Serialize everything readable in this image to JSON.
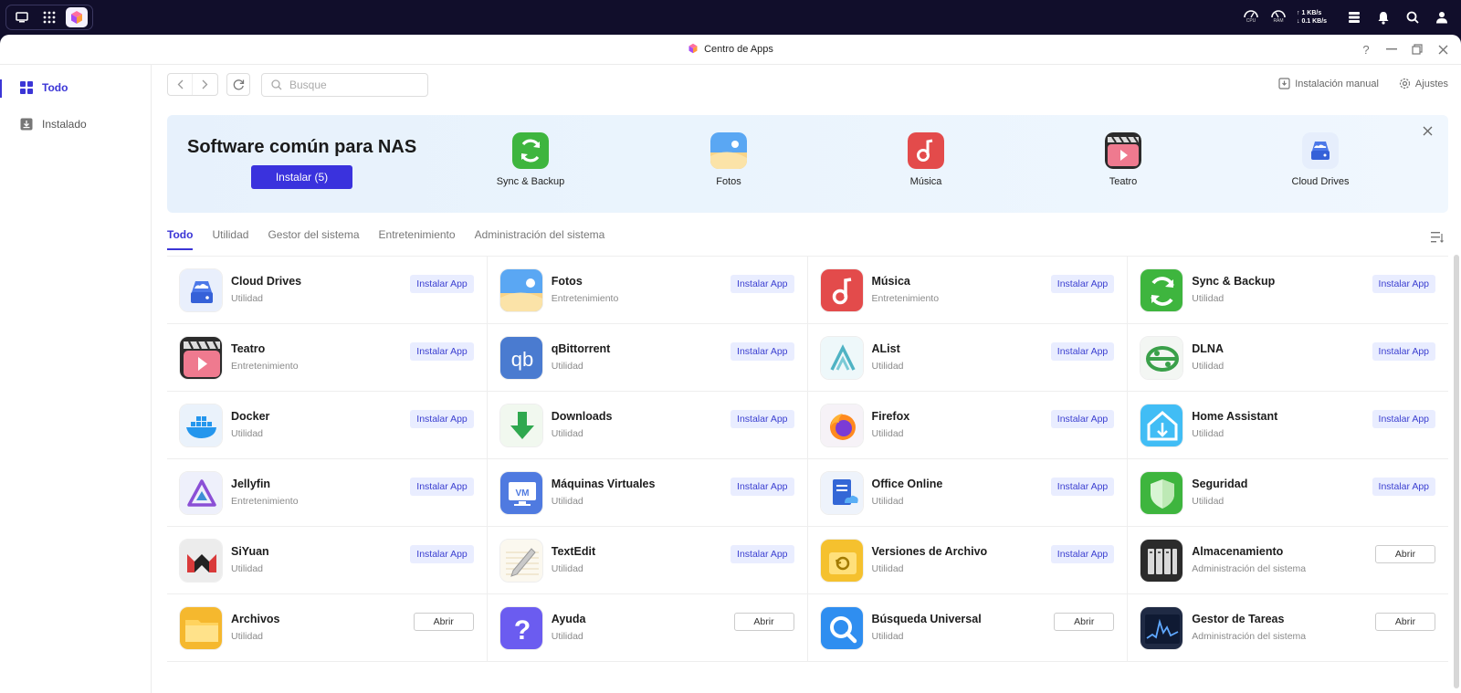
{
  "system_bar": {
    "cpu_label": "CPU",
    "ram_label": "RAM",
    "net_up": "↑ 1 KB/s",
    "net_down": "↓ 0.1 KB/s",
    "icons": [
      "desktop-icon",
      "apps-grid-icon",
      "app-center-icon",
      "widgets-icon",
      "bell-icon",
      "search-icon",
      "user-icon"
    ]
  },
  "window": {
    "title": "Centro de Apps",
    "controls": [
      "help-icon",
      "minimize-icon",
      "restore-icon",
      "close-icon"
    ],
    "help": "?"
  },
  "sidebar": {
    "items": [
      {
        "label": "Todo",
        "icon": "grid-icon",
        "active": true
      },
      {
        "label": "Instalado",
        "icon": "download-icon",
        "active": false
      }
    ]
  },
  "toolbar": {
    "search_placeholder": "Busque",
    "manual_install": "Instalación manual",
    "settings": "Ajustes"
  },
  "banner": {
    "title": "Software común para NAS",
    "install_button": "Instalar (5)",
    "apps": [
      {
        "label": "Sync & Backup",
        "icon": "sync-backup-icon"
      },
      {
        "label": "Fotos",
        "icon": "photos-icon"
      },
      {
        "label": "Música",
        "icon": "music-icon"
      },
      {
        "label": "Teatro",
        "icon": "theater-icon"
      },
      {
        "label": "Cloud Drives",
        "icon": "cloud-drives-icon"
      }
    ]
  },
  "tabs": [
    {
      "label": "Todo",
      "active": true
    },
    {
      "label": "Utilidad",
      "active": false
    },
    {
      "label": "Gestor del sistema",
      "active": false
    },
    {
      "label": "Entretenimiento",
      "active": false
    },
    {
      "label": "Administración del sistema",
      "active": false
    }
  ],
  "apps": [
    {
      "name": "Cloud Drives",
      "category": "Utilidad",
      "action": "Instalar App",
      "icon": "cloud-drives-icon"
    },
    {
      "name": "Fotos",
      "category": "Entretenimiento",
      "action": "Instalar App",
      "icon": "photos-icon"
    },
    {
      "name": "Música",
      "category": "Entretenimiento",
      "action": "Instalar App",
      "icon": "music-icon"
    },
    {
      "name": "Sync & Backup",
      "category": "Utilidad",
      "action": "Instalar App",
      "icon": "sync-backup-icon"
    },
    {
      "name": "Teatro",
      "category": "Entretenimiento",
      "action": "Instalar App",
      "icon": "theater-icon"
    },
    {
      "name": "qBittorrent",
      "category": "Utilidad",
      "action": "Instalar App",
      "icon": "qbittorrent-icon"
    },
    {
      "name": "AList",
      "category": "Utilidad",
      "action": "Instalar App",
      "icon": "alist-icon"
    },
    {
      "name": "DLNA",
      "category": "Utilidad",
      "action": "Instalar App",
      "icon": "dlna-icon"
    },
    {
      "name": "Docker",
      "category": "Utilidad",
      "action": "Instalar App",
      "icon": "docker-icon"
    },
    {
      "name": "Downloads",
      "category": "Utilidad",
      "action": "Instalar App",
      "icon": "downloads-icon"
    },
    {
      "name": "Firefox",
      "category": "Utilidad",
      "action": "Instalar App",
      "icon": "firefox-icon"
    },
    {
      "name": "Home Assistant",
      "category": "Utilidad",
      "action": "Instalar App",
      "icon": "home-assistant-icon"
    },
    {
      "name": "Jellyfin",
      "category": "Entretenimiento",
      "action": "Instalar App",
      "icon": "jellyfin-icon"
    },
    {
      "name": "Máquinas Virtuales",
      "category": "Utilidad",
      "action": "Instalar App",
      "icon": "vm-icon"
    },
    {
      "name": "Office Online",
      "category": "Utilidad",
      "action": "Instalar App",
      "icon": "office-online-icon"
    },
    {
      "name": "Seguridad",
      "category": "Utilidad",
      "action": "Instalar App",
      "icon": "security-shield-icon"
    },
    {
      "name": "SiYuan",
      "category": "Utilidad",
      "action": "Instalar App",
      "icon": "siyuan-icon"
    },
    {
      "name": "TextEdit",
      "category": "Utilidad",
      "action": "Instalar App",
      "icon": "textedit-icon"
    },
    {
      "name": "Versiones de Archivo",
      "category": "Utilidad",
      "action": "Instalar App",
      "icon": "file-versions-icon"
    },
    {
      "name": "Almacenamiento",
      "category": "Administración del sistema",
      "action": "Abrir",
      "icon": "storage-icon"
    },
    {
      "name": "Archivos",
      "category": "Utilidad",
      "action": "Abrir",
      "icon": "folder-icon"
    },
    {
      "name": "Ayuda",
      "category": "Utilidad",
      "action": "Abrir",
      "icon": "help-icon"
    },
    {
      "name": "Búsqueda Universal",
      "category": "Utilidad",
      "action": "Abrir",
      "icon": "universal-search-icon"
    },
    {
      "name": "Gestor de Tareas",
      "category": "Administración del sistema",
      "action": "Abrir",
      "icon": "task-manager-icon"
    }
  ],
  "colors": {
    "accent": "#3b35d6",
    "install_bg": "#e9edff",
    "system_bar": "#110e2b"
  }
}
